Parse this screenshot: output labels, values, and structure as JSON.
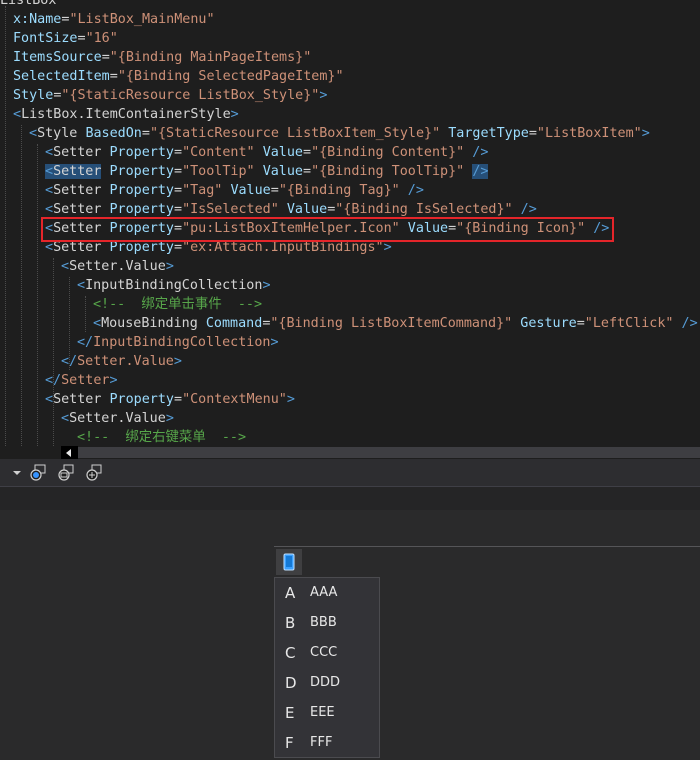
{
  "colors": {
    "tag": "#569cd6",
    "attribute": "#9cdcfe",
    "string": "#ce9178",
    "comment": "#57a64a",
    "text": "#d4d4d4",
    "highlight_box": "#e5252a",
    "selection": "#264f78"
  },
  "editor": {
    "lines": [
      [
        {
          "t": "ListBox",
          "c": "text"
        }
      ],
      [
        {
          "t": "x:Name",
          "c": "attribute"
        },
        {
          "t": "=",
          "c": "text"
        },
        {
          "t": "\"ListBox_MainMenu\"",
          "c": "string"
        }
      ],
      [
        {
          "t": "FontSize",
          "c": "attribute"
        },
        {
          "t": "=",
          "c": "text"
        },
        {
          "t": "\"16\"",
          "c": "string"
        }
      ],
      [
        {
          "t": "ItemsSource",
          "c": "attribute"
        },
        {
          "t": "=",
          "c": "text"
        },
        {
          "t": "\"{Binding MainPageItems}\"",
          "c": "string"
        }
      ],
      [
        {
          "t": "SelectedItem",
          "c": "attribute"
        },
        {
          "t": "=",
          "c": "text"
        },
        {
          "t": "\"{Binding SelectedPageItem}\"",
          "c": "string"
        }
      ],
      [
        {
          "t": "Style",
          "c": "attribute"
        },
        {
          "t": "=",
          "c": "text"
        },
        {
          "t": "\"{StaticResource ListBox_Style}\"",
          "c": "string"
        },
        {
          "t": ">",
          "c": "tag"
        }
      ],
      [
        {
          "t": "<",
          "c": "tag"
        },
        {
          "t": "ListBox.ItemContainerStyle",
          "c": "text"
        },
        {
          "t": ">",
          "c": "tag"
        }
      ],
      [
        {
          "t": "<",
          "c": "tag"
        },
        {
          "t": "Style ",
          "c": "text"
        },
        {
          "t": "BasedOn",
          "c": "attribute"
        },
        {
          "t": "=",
          "c": "text"
        },
        {
          "t": "\"{StaticResource ListBoxItem_Style}\"",
          "c": "string"
        },
        {
          "t": " ",
          "c": "text"
        },
        {
          "t": "TargetType",
          "c": "attribute"
        },
        {
          "t": "=",
          "c": "text"
        },
        {
          "t": "\"ListBoxItem\"",
          "c": "string"
        },
        {
          "t": ">",
          "c": "tag"
        }
      ],
      [
        {
          "t": "<",
          "c": "tag"
        },
        {
          "t": "Setter ",
          "c": "text"
        },
        {
          "t": "Property",
          "c": "attribute"
        },
        {
          "t": "=",
          "c": "text"
        },
        {
          "t": "\"Content\"",
          "c": "string"
        },
        {
          "t": " ",
          "c": "text"
        },
        {
          "t": "Value",
          "c": "attribute"
        },
        {
          "t": "=",
          "c": "text"
        },
        {
          "t": "\"{Binding Content}\"",
          "c": "string"
        },
        {
          "t": " />",
          "c": "tag"
        }
      ],
      [
        {
          "t": "<",
          "c": "tag",
          "sel": true
        },
        {
          "t": "Setter",
          "c": "text",
          "sel": true
        },
        {
          "t": " ",
          "c": "text"
        },
        {
          "t": "Property",
          "c": "attribute"
        },
        {
          "t": "=",
          "c": "text"
        },
        {
          "t": "\"ToolTip\"",
          "c": "string"
        },
        {
          "t": " ",
          "c": "text"
        },
        {
          "t": "Value",
          "c": "attribute"
        },
        {
          "t": "=",
          "c": "text"
        },
        {
          "t": "\"{Binding ToolTip}\"",
          "c": "string"
        },
        {
          "t": " ",
          "c": "text"
        },
        {
          "t": "/>",
          "c": "tag",
          "sel": true
        }
      ],
      [
        {
          "t": "<",
          "c": "tag"
        },
        {
          "t": "Setter ",
          "c": "text"
        },
        {
          "t": "Property",
          "c": "attribute"
        },
        {
          "t": "=",
          "c": "text"
        },
        {
          "t": "\"Tag\"",
          "c": "string"
        },
        {
          "t": " ",
          "c": "text"
        },
        {
          "t": "Value",
          "c": "attribute"
        },
        {
          "t": "=",
          "c": "text"
        },
        {
          "t": "\"{Binding Tag}\"",
          "c": "string"
        },
        {
          "t": " />",
          "c": "tag"
        }
      ],
      [
        {
          "t": "<",
          "c": "tag"
        },
        {
          "t": "Setter ",
          "c": "text"
        },
        {
          "t": "Property",
          "c": "attribute"
        },
        {
          "t": "=",
          "c": "text"
        },
        {
          "t": "\"IsSelected\"",
          "c": "string"
        },
        {
          "t": " ",
          "c": "text"
        },
        {
          "t": "Value",
          "c": "attribute"
        },
        {
          "t": "=",
          "c": "text"
        },
        {
          "t": "\"{Binding IsSelected}\"",
          "c": "string"
        },
        {
          "t": " />",
          "c": "tag"
        }
      ],
      [
        {
          "t": "<",
          "c": "tag"
        },
        {
          "t": "Setter ",
          "c": "text"
        },
        {
          "t": "Property",
          "c": "attribute"
        },
        {
          "t": "=",
          "c": "text"
        },
        {
          "t": "\"pu:ListBoxItemHelper.Icon\"",
          "c": "string"
        },
        {
          "t": " ",
          "c": "text"
        },
        {
          "t": "Value",
          "c": "attribute"
        },
        {
          "t": "=",
          "c": "text"
        },
        {
          "t": "\"{Binding Icon}\"",
          "c": "string"
        },
        {
          "t": " />",
          "c": "tag"
        }
      ],
      [
        {
          "t": "<",
          "c": "tag"
        },
        {
          "t": "Setter ",
          "c": "text"
        },
        {
          "t": "Property",
          "c": "attribute"
        },
        {
          "t": "=",
          "c": "text"
        },
        {
          "t": "\"ex:Attach.InputBindings\"",
          "c": "string"
        },
        {
          "t": ">",
          "c": "tag"
        }
      ],
      [
        {
          "t": "<",
          "c": "tag"
        },
        {
          "t": "Setter.Value",
          "c": "text"
        },
        {
          "t": ">",
          "c": "tag"
        }
      ],
      [
        {
          "t": "<",
          "c": "tag"
        },
        {
          "t": "InputBindingCollection",
          "c": "text"
        },
        {
          "t": ">",
          "c": "tag"
        }
      ],
      [
        {
          "t": "<!--  绑定单击事件  -->",
          "c": "comment"
        }
      ],
      [
        {
          "t": "<",
          "c": "tag"
        },
        {
          "t": "MouseBinding ",
          "c": "text"
        },
        {
          "t": "Command",
          "c": "attribute"
        },
        {
          "t": "=",
          "c": "text"
        },
        {
          "t": "\"{Binding ListBoxItemCommand}\"",
          "c": "string"
        },
        {
          "t": " ",
          "c": "text"
        },
        {
          "t": "Gesture",
          "c": "attribute"
        },
        {
          "t": "=",
          "c": "text"
        },
        {
          "t": "\"LeftClick\"",
          "c": "string"
        },
        {
          "t": " />",
          "c": "tag"
        }
      ],
      [
        {
          "t": "</",
          "c": "tag"
        },
        {
          "t": "InputBindingCollection",
          "c": "string"
        },
        {
          "t": ">",
          "c": "tag"
        }
      ],
      [
        {
          "t": "</",
          "c": "tag"
        },
        {
          "t": "Setter.Value",
          "c": "string"
        },
        {
          "t": ">",
          "c": "tag"
        }
      ],
      [
        {
          "t": "</",
          "c": "tag"
        },
        {
          "t": "Setter",
          "c": "string"
        },
        {
          "t": ">",
          "c": "tag"
        }
      ],
      [
        {
          "t": "<",
          "c": "tag"
        },
        {
          "t": "Setter ",
          "c": "text"
        },
        {
          "t": "Property",
          "c": "attribute"
        },
        {
          "t": "=",
          "c": "text"
        },
        {
          "t": "\"ContextMenu\"",
          "c": "string"
        },
        {
          "t": ">",
          "c": "tag"
        }
      ],
      [
        {
          "t": "<",
          "c": "tag"
        },
        {
          "t": "Setter.Value",
          "c": "text"
        },
        {
          "t": ">",
          "c": "tag"
        }
      ],
      [
        {
          "t": "<!--  绑定右键菜单  -->",
          "c": "comment"
        }
      ]
    ]
  },
  "toolbar": {
    "icons": [
      "dropdown-arrow-icon",
      "zoom-fit-icon",
      "toggle-artboard-icon",
      "snap-grid-icon"
    ]
  },
  "designer": {
    "menu_toggle_icon": "tablet-icon",
    "menu_items": [
      {
        "icon": "A",
        "label": "AAA"
      },
      {
        "icon": "B",
        "label": "BBB"
      },
      {
        "icon": "C",
        "label": "CCC"
      },
      {
        "icon": "D",
        "label": "DDD"
      },
      {
        "icon": "E",
        "label": "EEE"
      },
      {
        "icon": "F",
        "label": "FFF"
      }
    ]
  }
}
